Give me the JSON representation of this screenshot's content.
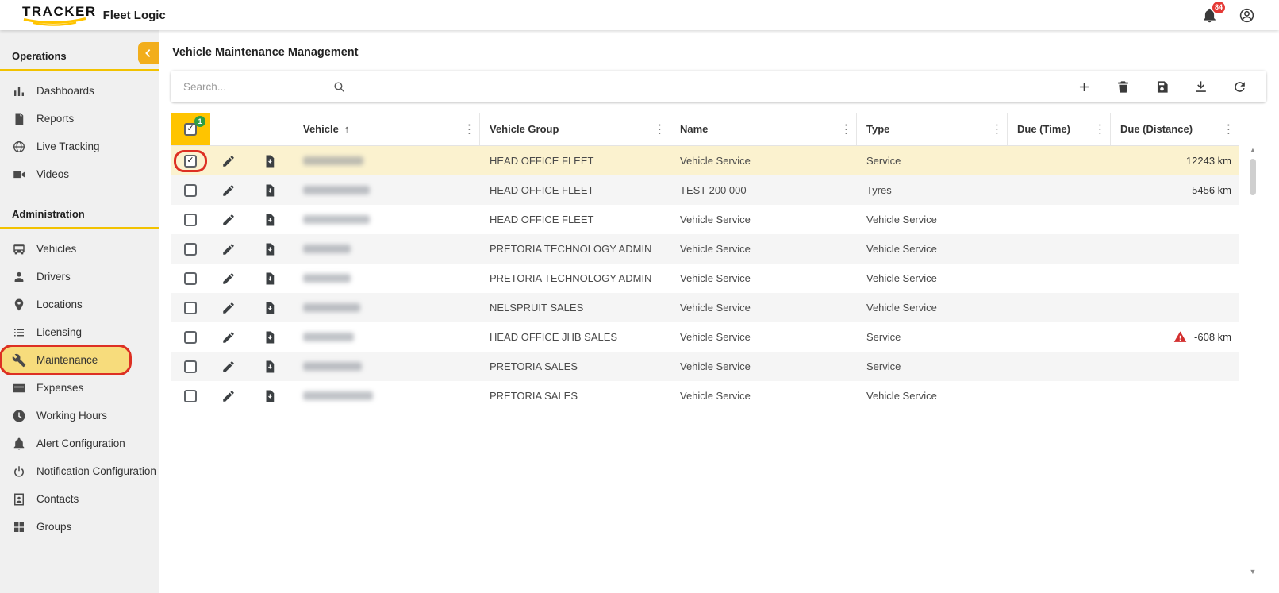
{
  "colors": {
    "accent_yellow": "#FFC400",
    "collapse_button_yellow": "#F2AE1C",
    "active_item_bg": "#F7DC7C",
    "selected_row_bg": "#FBF2CF",
    "badge_green": "#2E9E44",
    "badge_red": "#E53935",
    "warning_red": "#D32F2F",
    "annotation_red": "#DD3023"
  },
  "header": {
    "brand_primary": "TRACKER",
    "brand_secondary": "Fleet Logic",
    "notification_count": "84"
  },
  "sidebar": {
    "sections": [
      {
        "title": "Operations",
        "items": [
          {
            "label": "Dashboards",
            "icon": "dashboard"
          },
          {
            "label": "Reports",
            "icon": "report"
          },
          {
            "label": "Live Tracking",
            "icon": "globe"
          },
          {
            "label": "Videos",
            "icon": "video"
          }
        ]
      },
      {
        "title": "Administration",
        "items": [
          {
            "label": "Vehicles",
            "icon": "vehicle"
          },
          {
            "label": "Drivers",
            "icon": "person"
          },
          {
            "label": "Locations",
            "icon": "pin"
          },
          {
            "label": "Licensing",
            "icon": "list"
          },
          {
            "label": "Maintenance",
            "icon": "wrench",
            "active": true,
            "annotated": true
          },
          {
            "label": "Expenses",
            "icon": "card"
          },
          {
            "label": "Working Hours",
            "icon": "clock"
          },
          {
            "label": "Alert Configuration",
            "icon": "bell"
          },
          {
            "label": "Notification Configuration",
            "icon": "broadcast"
          },
          {
            "label": "Contacts",
            "icon": "contact"
          },
          {
            "label": "Groups",
            "icon": "grid"
          }
        ]
      }
    ]
  },
  "main": {
    "title": "Vehicle Maintenance Management",
    "search": {
      "placeholder": "Search..."
    },
    "toolbar_actions": [
      {
        "name": "add",
        "icon": "plus"
      },
      {
        "name": "delete",
        "icon": "trash"
      },
      {
        "name": "save",
        "icon": "floppy"
      },
      {
        "name": "download",
        "icon": "download"
      },
      {
        "name": "refresh",
        "icon": "refresh"
      }
    ],
    "table": {
      "select_all_badge": "1",
      "columns": [
        {
          "key": "vehicle",
          "label": "Vehicle",
          "sort": "asc"
        },
        {
          "key": "vehicle_group",
          "label": "Vehicle Group"
        },
        {
          "key": "name",
          "label": "Name"
        },
        {
          "key": "type",
          "label": "Type"
        },
        {
          "key": "due_time",
          "label": "Due (Time)"
        },
        {
          "key": "due_distance",
          "label": "Due (Distance)"
        }
      ],
      "rows": [
        {
          "checked": true,
          "selected": true,
          "annotated": true,
          "vehicle_group": "HEAD OFFICE FLEET",
          "name": "Vehicle Service",
          "type": "Service",
          "due_time": "",
          "due_distance": "12243 km",
          "warning": false
        },
        {
          "checked": false,
          "vehicle_group": "HEAD OFFICE FLEET",
          "name": "TEST 200 000",
          "type": "Tyres",
          "due_time": "",
          "due_distance": "5456 km",
          "warning": false
        },
        {
          "checked": false,
          "vehicle_group": "HEAD OFFICE FLEET",
          "name": "Vehicle Service",
          "type": "Vehicle Service",
          "due_time": "",
          "due_distance": "",
          "warning": false
        },
        {
          "checked": false,
          "vehicle_group": "PRETORIA TECHNOLOGY ADMIN",
          "name": "Vehicle Service",
          "type": "Vehicle Service",
          "due_time": "",
          "due_distance": "",
          "warning": false
        },
        {
          "checked": false,
          "vehicle_group": "PRETORIA TECHNOLOGY ADMIN",
          "name": "Vehicle Service",
          "type": "Vehicle Service",
          "due_time": "",
          "due_distance": "",
          "warning": false
        },
        {
          "checked": false,
          "vehicle_group": "NELSPRUIT SALES",
          "name": "Vehicle Service",
          "type": "Vehicle Service",
          "due_time": "",
          "due_distance": "",
          "warning": false
        },
        {
          "checked": false,
          "vehicle_group": "HEAD OFFICE JHB SALES",
          "name": "Vehicle Service",
          "type": "Service",
          "due_time": "",
          "due_distance": "-608 km",
          "warning": true
        },
        {
          "checked": false,
          "vehicle_group": "PRETORIA SALES",
          "name": "Vehicle Service",
          "type": "Service",
          "due_time": "",
          "due_distance": "",
          "warning": false
        },
        {
          "checked": false,
          "vehicle_group": "PRETORIA SALES",
          "name": "Vehicle Service",
          "type": "Vehicle Service",
          "due_time": "",
          "due_distance": "",
          "warning": false
        }
      ]
    }
  }
}
